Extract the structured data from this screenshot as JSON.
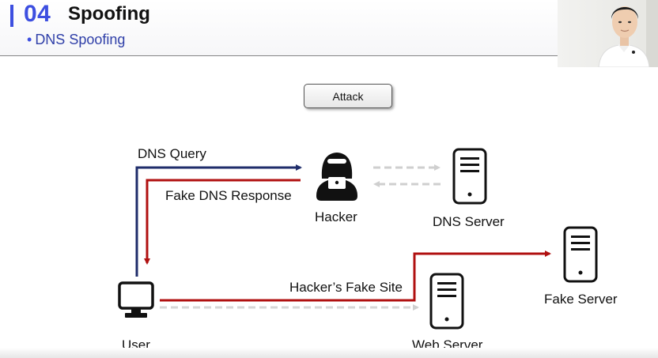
{
  "header": {
    "section_number": "04",
    "section_title": "Spoofing",
    "subtitle_bullet": "•",
    "subtitle": "DNS Spoofing"
  },
  "attack_button": {
    "label": "Attack"
  },
  "nodes": {
    "hacker": "Hacker",
    "dns_server": "DNS Server",
    "fake_server": "Fake Server",
    "user": "User",
    "web_server": "Web Server"
  },
  "arrows": {
    "dns_query": "DNS Query",
    "fake_dns_response": "Fake DNS Response",
    "hackers_fake_site": "Hacker’s Fake Site"
  },
  "colors": {
    "accent": "#3d4fe0",
    "query_line": "#1f2d6b",
    "attack_line": "#b01010",
    "dashed_line": "#cfcfcf"
  },
  "icons": [
    "hacker-icon",
    "dns-server-icon",
    "fake-server-icon",
    "web-server-icon",
    "user-monitor-icon"
  ]
}
